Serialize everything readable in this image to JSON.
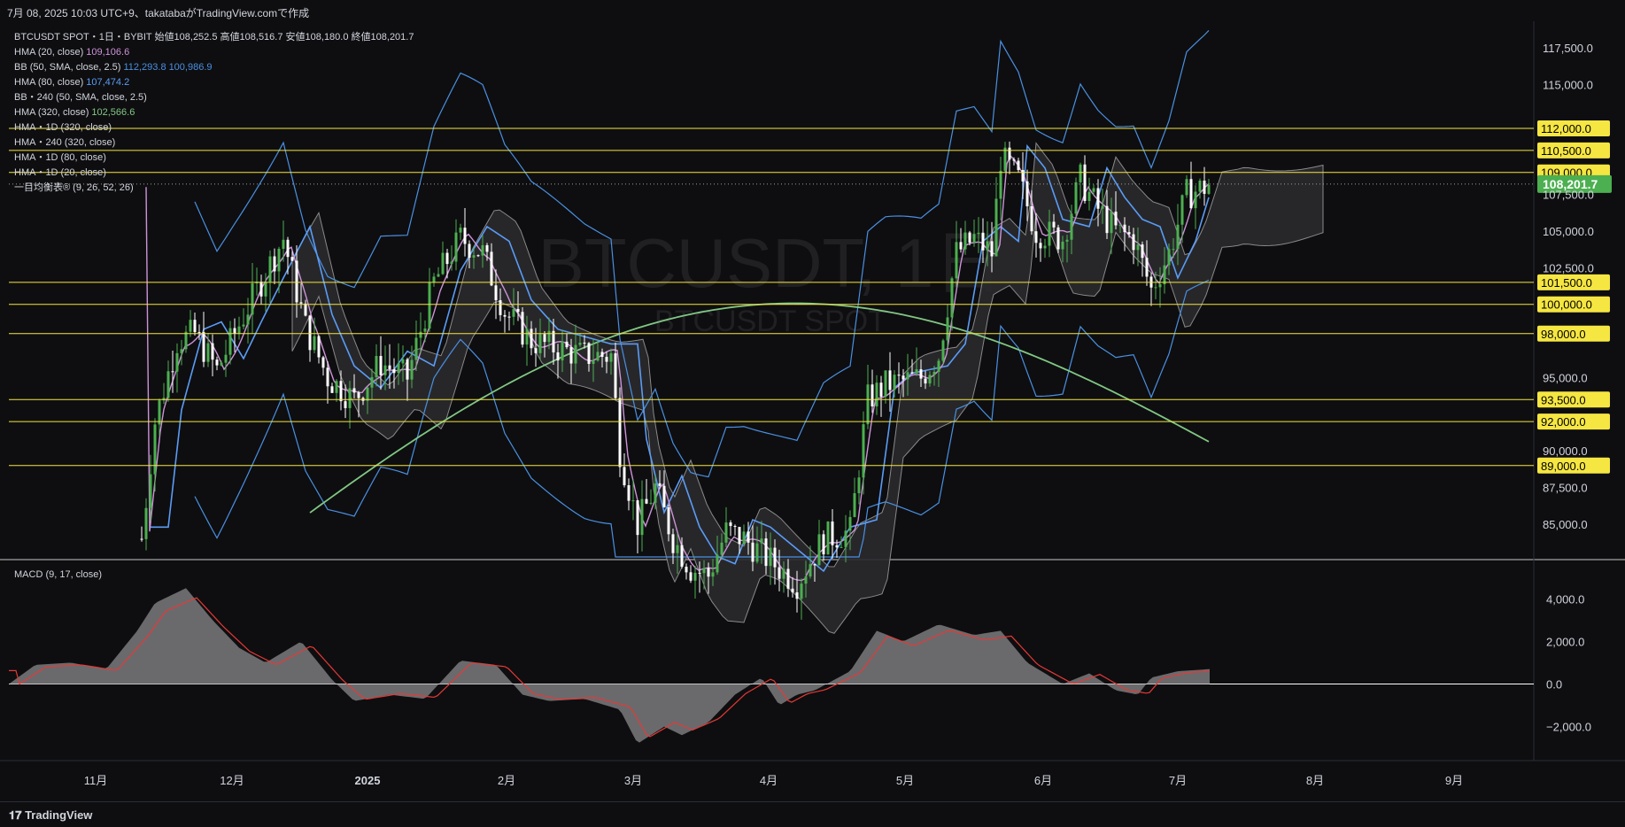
{
  "header": {
    "info": "7月 08, 2025 10:03 UTC+9、takatabaがTradingView.comで作成"
  },
  "symbol": {
    "title": "BTCUSDT SPOT・1日・BYBIT",
    "ohlc": [
      {
        "k": "始値",
        "v": "108,252.5"
      },
      {
        "k": "高値",
        "v": "108,516.7"
      },
      {
        "k": "安値",
        "v": "108,180.0"
      },
      {
        "k": "終値",
        "v": "108,201.7"
      }
    ]
  },
  "legend": [
    {
      "label": "HMA (20, close)",
      "values": [
        {
          "v": "109,106.6",
          "c": "#ce93d8"
        }
      ]
    },
    {
      "label": "BB (50, SMA, close, 2.5)",
      "values": [
        {
          "v": "112,293.8",
          "c": "#4a90e2"
        },
        {
          "v": "100,986.9",
          "c": "#4a90e2"
        }
      ]
    },
    {
      "label": "HMA (80, close)",
      "values": [
        {
          "v": "107,474.2",
          "c": "#5b9cf6"
        }
      ]
    },
    {
      "label": "BB・240 (50, SMA, close, 2.5)",
      "values": []
    },
    {
      "label": "HMA (320, close)",
      "values": [
        {
          "v": "102,566.6",
          "c": "#81c784"
        }
      ]
    },
    {
      "label": "HMA・1D (320, close)",
      "values": []
    },
    {
      "label": "HMA・240 (320, close)",
      "values": []
    },
    {
      "label": "HMA・1D (80, close)",
      "values": []
    },
    {
      "label": "HMA・1D (20, close)",
      "values": []
    },
    {
      "label": "一目均衡表® (9, 26, 52, 26)",
      "values": []
    }
  ],
  "watermark": {
    "main": "BTCUSDT, 1日",
    "sub": "BTCUSDT SPOT"
  },
  "price_axis": {
    "ticks": [
      "117,500.0",
      "115,000.0",
      "107,500.0",
      "105,000.0",
      "102,500.0",
      "95,000.0",
      "90,000.0",
      "87,500.0",
      "85,000.0"
    ],
    "levels": [
      "112,000.0",
      "110,500.0",
      "109,000.0",
      "101,500.0",
      "100,000.0",
      "98,000.0",
      "93,500.0",
      "92,000.0",
      "89,000.0"
    ],
    "current": "108,201.7"
  },
  "macd": {
    "label": "MACD (9, 17, close)",
    "ticks": [
      "4,000.0",
      "2,000.0",
      "0.0",
      "−2,000.0"
    ]
  },
  "time_axis": {
    "ticks": [
      "11月",
      "12月",
      "2025",
      "2月",
      "3月",
      "4月",
      "5月",
      "6月",
      "7月",
      "8月",
      "9月"
    ]
  },
  "footer": {
    "logo": "TradingView"
  },
  "colors": {
    "up": "#4caf50",
    "down": "#ffffff",
    "level": "#f5e642",
    "current": "#4caf50",
    "hma20": "#ce93d8",
    "hma80": "#5b9cf6",
    "hma320": "#81c784",
    "bb": "#4a90e2"
  }
}
